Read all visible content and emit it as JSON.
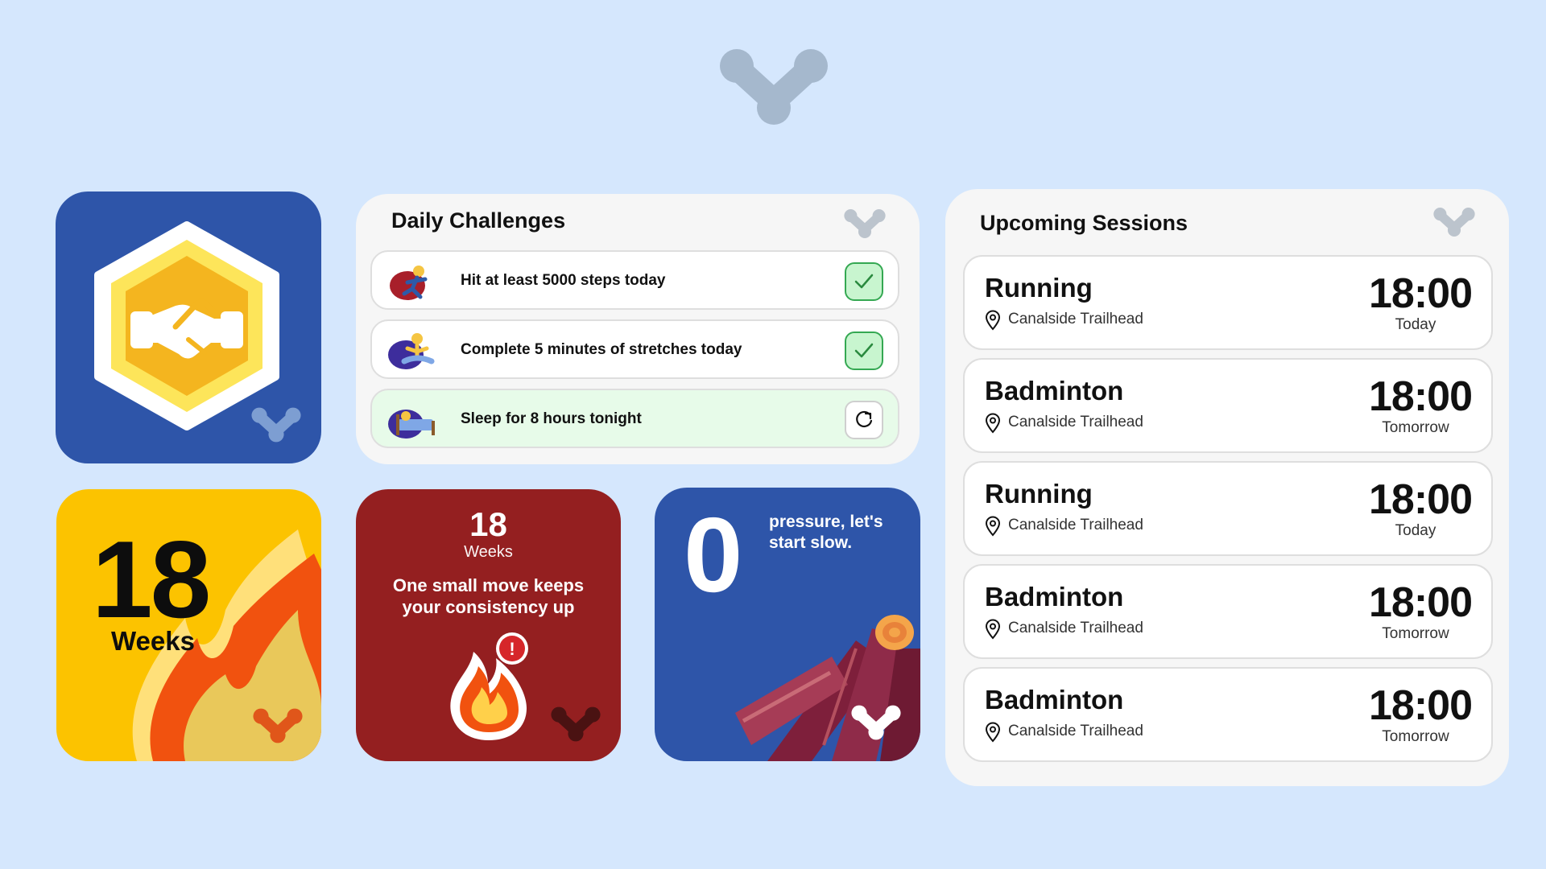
{
  "colors": {
    "background": "#d5e7fd",
    "brand_gray": "#a5b8cd",
    "badge_blue": "#2e55a9",
    "streak_yellow": "#fcc300",
    "reminder_red": "#941f20",
    "check_green": "#34a852"
  },
  "badge_widget": {
    "icon": "handshake-icon"
  },
  "streak_widget": {
    "count": "18",
    "unit": "Weeks"
  },
  "reminder_widget": {
    "count": "18",
    "unit": "Weeks",
    "message": "One small move keeps your consistency up",
    "alert_glyph": "!"
  },
  "zero_widget": {
    "count": "0",
    "message": "pressure, let's start slow."
  },
  "daily_challenges": {
    "title": "Daily Challenges",
    "items": [
      {
        "label": "Hit at least 5000 steps today",
        "status": "done",
        "icon": "running-person-icon"
      },
      {
        "label": "Complete 5 minutes of stretches today",
        "status": "done",
        "icon": "meditating-person-icon"
      },
      {
        "label": "Sleep for 8 hours tonight",
        "status": "pending",
        "icon": "person-in-bed-icon"
      }
    ]
  },
  "upcoming_sessions": {
    "title": "Upcoming Sessions",
    "items": [
      {
        "name": "Running",
        "location": "Canalside Trailhead",
        "time": "18:00",
        "day": "Today"
      },
      {
        "name": "Badminton",
        "location": "Canalside Trailhead",
        "time": "18:00",
        "day": "Tomorrow"
      },
      {
        "name": "Running",
        "location": "Canalside Trailhead",
        "time": "18:00",
        "day": "Today"
      },
      {
        "name": "Badminton",
        "location": "Canalside Trailhead",
        "time": "18:00",
        "day": "Tomorrow"
      },
      {
        "name": "Badminton",
        "location": "Canalside Trailhead",
        "time": "18:00",
        "day": "Tomorrow"
      }
    ]
  }
}
